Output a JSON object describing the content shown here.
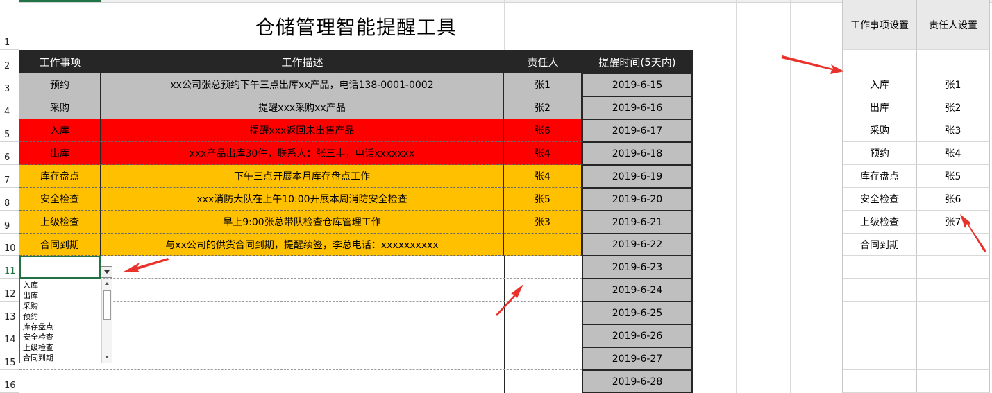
{
  "sheet": {
    "title": "仓储管理智能提醒工具",
    "row_numbers": [
      "1",
      "2",
      "3",
      "4",
      "5",
      "6",
      "7",
      "8",
      "9",
      "10",
      "11",
      "12",
      "13",
      "14",
      "15",
      "16"
    ],
    "headers": {
      "task": "工作事项",
      "desc": "工作描述",
      "owner": "责任人",
      "time": "提醒时间(5天内)"
    },
    "rows": [
      {
        "task": "预约",
        "desc": "xx公司张总预约下午三点出库xx产品，电话138-0001-0002",
        "owner": "张1",
        "date": "2019-6-15",
        "color": "#bfbfbf"
      },
      {
        "task": "采购",
        "desc": "提醒xxx采购xx产品",
        "owner": "张2",
        "date": "2019-6-16",
        "color": "#bfbfbf"
      },
      {
        "task": "入库",
        "desc": "提醒xxx返回未出售产品",
        "owner": "张6",
        "date": "2019-6-17",
        "color": "#ff0000"
      },
      {
        "task": "出库",
        "desc": "xxx产品出库30件，联系人：张三丰，电话xxxxxxx",
        "owner": "张4",
        "date": "2019-6-18",
        "color": "#ff0000"
      },
      {
        "task": "库存盘点",
        "desc": "下午三点开展本月库存盘点工作",
        "owner": "张4",
        "date": "2019-6-19",
        "color": "#ffc000"
      },
      {
        "task": "安全检查",
        "desc": "xxx消防大队在上午10:00开展本周消防安全检查",
        "owner": "张5",
        "date": "2019-6-20",
        "color": "#ffc000"
      },
      {
        "task": "上级检查",
        "desc": "早上9:00张总带队检查仓库管理工作",
        "owner": "张3",
        "date": "2019-6-21",
        "color": "#ffc000"
      },
      {
        "task": "合同到期",
        "desc": "与xx公司的供货合同到期，提醒续签，李总电话：xxxxxxxxxx",
        "owner": "",
        "date": "2019-6-22",
        "color": "#ffc000"
      }
    ],
    "empty_dates": [
      "2019-6-23",
      "2019-6-24",
      "2019-6-25",
      "2019-6-26",
      "2019-6-27",
      "2019-6-28"
    ]
  },
  "dropdown": {
    "options": [
      "入库",
      "出库",
      "采购",
      "预约",
      "库存盘点",
      "安全检查",
      "上级检查",
      "合同到期"
    ]
  },
  "settings": {
    "task_header": "工作事项设置",
    "owner_header": "责任人设置",
    "rows": [
      {
        "task": "入库",
        "owner": "张1"
      },
      {
        "task": "出库",
        "owner": "张2"
      },
      {
        "task": "采购",
        "owner": "张3"
      },
      {
        "task": "预约",
        "owner": "张4"
      },
      {
        "task": "库存盘点",
        "owner": "张5"
      },
      {
        "task": "安全检查",
        "owner": "张6"
      },
      {
        "task": "上级检查",
        "owner": "张7"
      },
      {
        "task": "合同到期",
        "owner": ""
      }
    ]
  },
  "colors": {
    "header_bg": "#262626",
    "gray": "#bfbfbf",
    "red": "#ff0000",
    "orange": "#ffc000",
    "arrow": "#e8322b",
    "excel_green": "#217346"
  }
}
